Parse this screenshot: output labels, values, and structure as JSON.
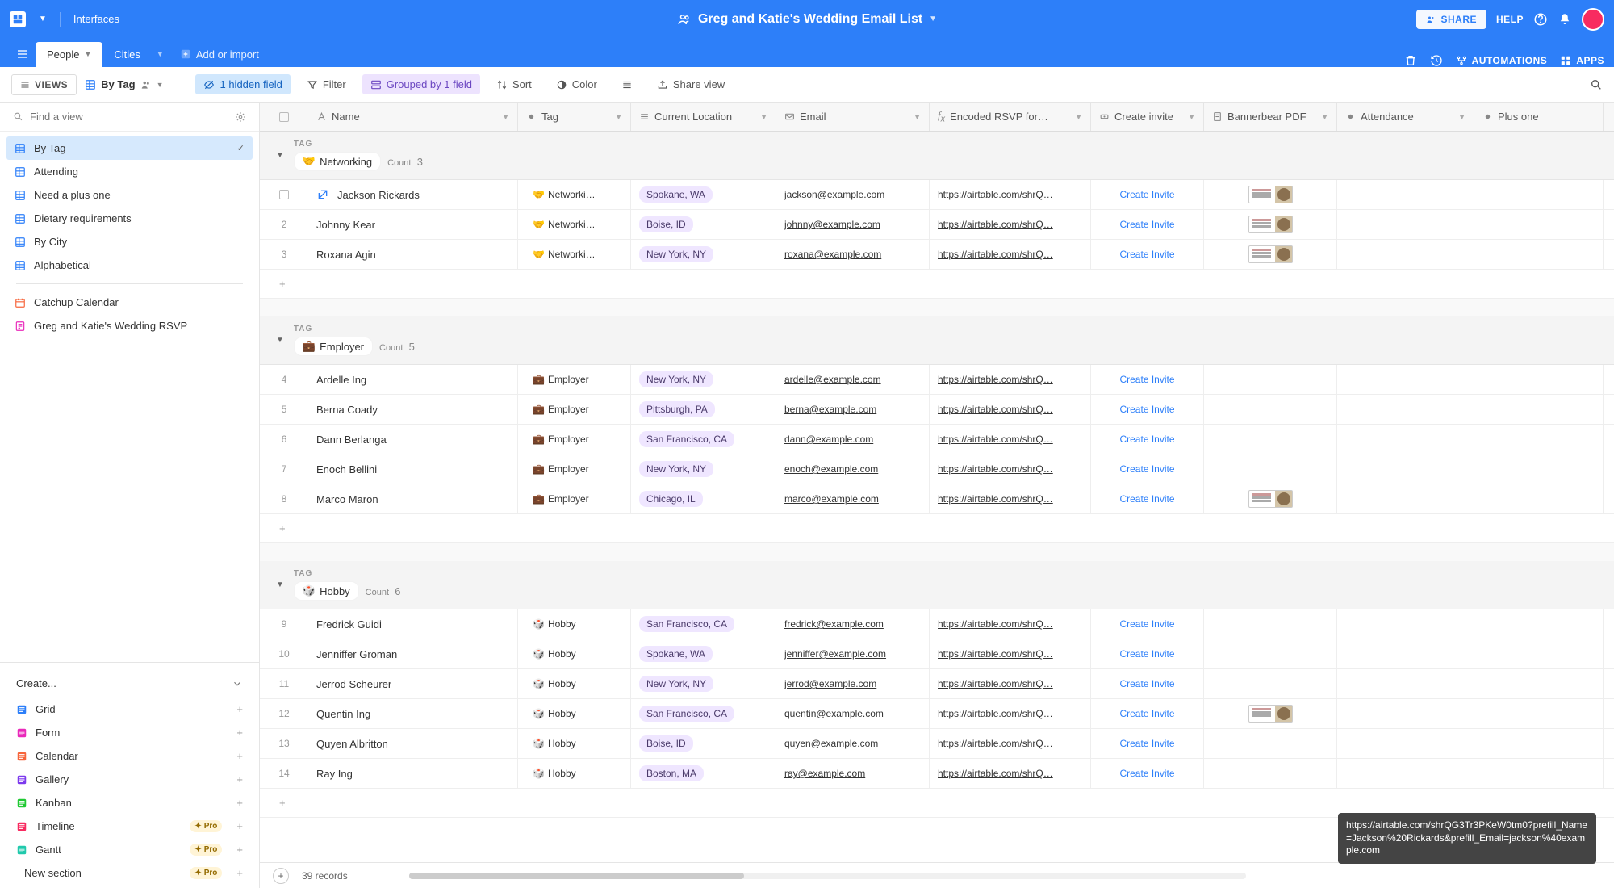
{
  "topbar": {
    "interfaces": "Interfaces",
    "title": "Greg and Katie's Wedding Email List",
    "share": "SHARE",
    "help": "HELP"
  },
  "tabs": {
    "people": "People",
    "cities": "Cities",
    "add_import": "Add or import",
    "automations": "AUTOMATIONS",
    "apps": "APPS"
  },
  "toolbar": {
    "views": "VIEWS",
    "view_name": "By Tag",
    "hidden": "1 hidden field",
    "filter": "Filter",
    "grouped": "Grouped by 1 field",
    "sort": "Sort",
    "color": "Color",
    "share_view": "Share view"
  },
  "sidebar": {
    "search_placeholder": "Find a view",
    "views": [
      {
        "label": "By Tag",
        "type": "grid",
        "active": true
      },
      {
        "label": "Attending",
        "type": "grid"
      },
      {
        "label": "Need a plus one",
        "type": "grid"
      },
      {
        "label": "Dietary requirements",
        "type": "grid"
      },
      {
        "label": "By City",
        "type": "grid"
      },
      {
        "label": "Alphabetical",
        "type": "grid"
      },
      {
        "label": "Catchup Calendar",
        "type": "calendar"
      },
      {
        "label": "Greg and Katie's Wedding RSVP",
        "type": "form"
      }
    ],
    "create_label": "Create...",
    "create_items": [
      {
        "label": "Grid",
        "color": "#2d7ff9"
      },
      {
        "label": "Form",
        "color": "#e929ba"
      },
      {
        "label": "Calendar",
        "color": "#f7653b"
      },
      {
        "label": "Gallery",
        "color": "#7c39ed"
      },
      {
        "label": "Kanban",
        "color": "#20c933"
      },
      {
        "label": "Timeline",
        "color": "#f82b60",
        "pro": true
      },
      {
        "label": "Gantt",
        "color": "#20c9ac",
        "pro": true
      },
      {
        "label": "New section",
        "pro": true
      }
    ],
    "pro_label": "Pro"
  },
  "columns": {
    "name": "Name",
    "tag": "Tag",
    "location": "Current Location",
    "email": "Email",
    "rsvp": "Encoded RSVP for…",
    "invite": "Create invite",
    "pdf": "Bannerbear PDF",
    "attendance": "Attendance",
    "plusone": "Plus one"
  },
  "group_label": "TAG",
  "count_label": "Count",
  "invite_label": "Create Invite",
  "rsvp_text": "https://airtable.com/shrQ…",
  "groups": [
    {
      "name": "Networking",
      "emoji": "🤝",
      "count": 3,
      "rows": [
        {
          "n": "",
          "expand": true,
          "name": "Jackson Rickards",
          "tag": "Networki…",
          "loc": "Spokane, WA",
          "email": "jackson@example.com",
          "pdf": true
        },
        {
          "n": "2",
          "name": "Johnny Kear",
          "tag": "Networki…",
          "loc": "Boise, ID",
          "email": "johnny@example.com",
          "pdf": true
        },
        {
          "n": "3",
          "name": "Roxana Agin",
          "tag": "Networki…",
          "loc": "New York, NY",
          "email": "roxana@example.com",
          "pdf": true
        }
      ]
    },
    {
      "name": "Employer",
      "emoji": "💼",
      "count": 5,
      "rows": [
        {
          "n": "4",
          "name": "Ardelle Ing",
          "tag": "Employer",
          "loc": "New York, NY",
          "email": "ardelle@example.com"
        },
        {
          "n": "5",
          "name": "Berna Coady",
          "tag": "Employer",
          "loc": "Pittsburgh, PA",
          "email": "berna@example.com"
        },
        {
          "n": "6",
          "name": "Dann Berlanga",
          "tag": "Employer",
          "loc": "San Francisco, CA",
          "email": "dann@example.com"
        },
        {
          "n": "7",
          "name": "Enoch Bellini",
          "tag": "Employer",
          "loc": "New York, NY",
          "email": "enoch@example.com"
        },
        {
          "n": "8",
          "name": "Marco Maron",
          "tag": "Employer",
          "loc": "Chicago, IL",
          "email": "marco@example.com",
          "pdf": true
        }
      ]
    },
    {
      "name": "Hobby",
      "emoji": "🎲",
      "count": 6,
      "rows": [
        {
          "n": "9",
          "name": "Fredrick Guidi",
          "tag": "Hobby",
          "loc": "San Francisco, CA",
          "email": "fredrick@example.com"
        },
        {
          "n": "10",
          "name": "Jenniffer Groman",
          "tag": "Hobby",
          "loc": "Spokane, WA",
          "email": "jenniffer@example.com"
        },
        {
          "n": "11",
          "name": "Jerrod Scheurer",
          "tag": "Hobby",
          "loc": "New York, NY",
          "email": "jerrod@example.com"
        },
        {
          "n": "12",
          "name": "Quentin Ing",
          "tag": "Hobby",
          "loc": "San Francisco, CA",
          "email": "quentin@example.com",
          "pdf": true
        },
        {
          "n": "13",
          "name": "Quyen Albritton",
          "tag": "Hobby",
          "loc": "Boise, ID",
          "email": "quyen@example.com"
        },
        {
          "n": "14",
          "name": "Ray Ing",
          "tag": "Hobby",
          "loc": "Boston, MA",
          "email": "ray@example.com"
        }
      ]
    }
  ],
  "status": {
    "records": "39 records"
  },
  "tooltip": "https://airtable.com/shrQG3Tr3PKeW0tm0?prefill_Name=Jackson%20Rickards&prefill_Email=jackson%40example.com"
}
